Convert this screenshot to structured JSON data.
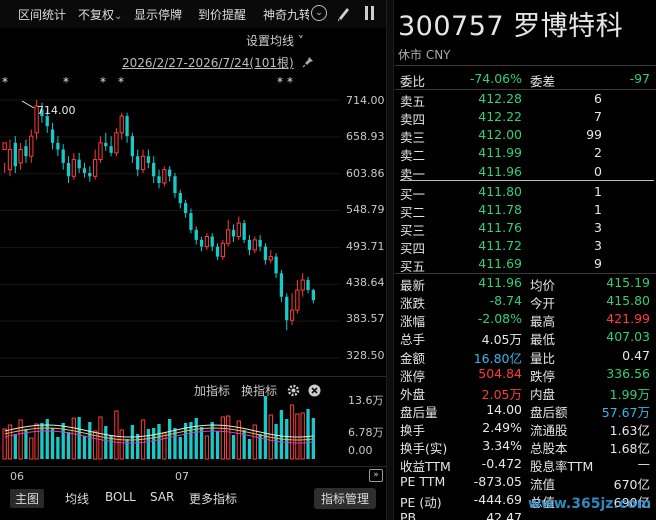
{
  "toolbar": {
    "items": [
      "区间统计",
      "不复权",
      "显示停牌",
      "到价提醒",
      "神奇九转"
    ],
    "dropdown_chev": "⌄",
    "circle_chev": "⌄"
  },
  "chart_header": {
    "ma_setting": "设置均线",
    "date_range": "2026/2/27-2026/7/24(101根)"
  },
  "price_axis": [
    "714.00",
    "658.93",
    "603.86",
    "548.79",
    "493.71",
    "438.64",
    "383.57",
    "328.50"
  ],
  "max_label": "714.00",
  "indicator_bar": {
    "add": "加指标",
    "switch": "换指标"
  },
  "volume_axis": [
    "13.6万",
    "6.78万",
    "0.00"
  ],
  "months": [
    "06",
    "07"
  ],
  "bottom_bar": {
    "items": [
      "主图",
      "均线",
      "BOLL",
      "SAR",
      "更多指标"
    ],
    "manage": "指标管理"
  },
  "stock": {
    "title": "300757 罗博特科",
    "status": "休市 CNY"
  },
  "order_ratio": {
    "label1": "委比",
    "value1": "-74.06%",
    "label2": "委差",
    "value2": "-97"
  },
  "asks": [
    {
      "label": "卖五",
      "price": "412.28",
      "vol": "6"
    },
    {
      "label": "卖四",
      "price": "412.22",
      "vol": "7"
    },
    {
      "label": "卖三",
      "price": "412.00",
      "vol": "99"
    },
    {
      "label": "卖二",
      "price": "411.99",
      "vol": "2"
    },
    {
      "label": "卖一",
      "price": "411.96",
      "vol": "0"
    }
  ],
  "bids": [
    {
      "label": "买一",
      "price": "411.80",
      "vol": "1"
    },
    {
      "label": "买二",
      "price": "411.78",
      "vol": "1"
    },
    {
      "label": "买三",
      "price": "411.76",
      "vol": "3"
    },
    {
      "label": "买四",
      "price": "411.72",
      "vol": "3"
    },
    {
      "label": "买五",
      "price": "411.69",
      "vol": "9"
    }
  ],
  "stats": [
    {
      "l1": "最新",
      "v1": "411.96",
      "c1": "green",
      "l2": "均价",
      "v2": "415.19",
      "c2": "green"
    },
    {
      "l1": "涨跌",
      "v1": "-8.74",
      "c1": "green",
      "l2": "今开",
      "v2": "415.80",
      "c2": "green"
    },
    {
      "l1": "涨幅",
      "v1": "-2.08%",
      "c1": "green",
      "l2": "最高",
      "v2": "421.99",
      "c2": "red"
    },
    {
      "l1": "总手",
      "v1": "4.05万",
      "c1": "white",
      "l2": "最低",
      "v2": "407.03",
      "c2": "green"
    },
    {
      "l1": "金额",
      "v1": "16.80亿",
      "c1": "cyan",
      "l2": "量比",
      "v2": "0.47",
      "c2": "white"
    },
    {
      "l1": "涨停",
      "v1": "504.84",
      "c1": "red",
      "l2": "跌停",
      "v2": "336.56",
      "c2": "green"
    },
    {
      "l1": "外盘",
      "v1": "2.05万",
      "c1": "red",
      "l2": "内盘",
      "v2": "1.99万",
      "c2": "green"
    },
    {
      "l1": "盘后量",
      "v1": "14.00",
      "c1": "white",
      "l2": "盘后额",
      "v2": "57.67万",
      "c2": "cyan"
    },
    {
      "l1": "换手",
      "v1": "2.49%",
      "c1": "white",
      "l2": "流通股",
      "v2": "1.63亿",
      "c2": "white"
    },
    {
      "l1": "换手(实)",
      "v1": "3.34%",
      "c1": "white",
      "l2": "总股本",
      "v2": "1.68亿",
      "c2": "white"
    },
    {
      "l1": "收益TTM",
      "v1": "-0.472",
      "c1": "white",
      "l2": "股息率TTM",
      "v2": "—",
      "c2": "white"
    },
    {
      "l1": "PE TTM",
      "v1": "-873.05",
      "c1": "white",
      "l2": "流值",
      "v2": "670亿",
      "c2": "white"
    },
    {
      "l1": "PE (动)",
      "v1": "-444.69",
      "c1": "white",
      "l2": "总值",
      "v2": "690亿",
      "c2": "white"
    },
    {
      "l1": "PB",
      "v1": "42.47",
      "c1": "white",
      "l2": "",
      "v2": "",
      "c2": "white"
    }
  ],
  "colors": {
    "up": "#ff3b3b",
    "down": "#19c9c9",
    "ma5": "#e8e8e8",
    "ma10": "#e0c040",
    "ma20": "#d040d0"
  },
  "chart_data": {
    "type": "candlestick",
    "ylim": [
      328.5,
      714.0
    ],
    "volume_ylim": [
      0,
      136000
    ],
    "candles": [
      [
        640,
        650,
        620,
        605
      ],
      [
        610,
        640,
        655,
        600
      ],
      [
        650,
        615,
        660,
        605
      ],
      [
        620,
        640,
        650,
        610
      ],
      [
        645,
        630,
        655,
        620
      ],
      [
        630,
        660,
        670,
        620
      ],
      [
        665,
        705,
        714,
        655
      ],
      [
        700,
        690,
        710,
        680
      ],
      [
        690,
        675,
        700,
        665
      ],
      [
        670,
        650,
        680,
        640
      ],
      [
        650,
        640,
        660,
        630
      ],
      [
        640,
        620,
        648,
        610
      ],
      [
        620,
        600,
        630,
        590
      ],
      [
        600,
        625,
        635,
        595
      ],
      [
        625,
        612,
        635,
        605
      ],
      [
        612,
        605,
        620,
        598
      ],
      [
        605,
        600,
        615,
        592
      ],
      [
        600,
        625,
        640,
        595
      ],
      [
        625,
        650,
        660,
        620
      ],
      [
        650,
        645,
        665,
        638
      ],
      [
        645,
        635,
        660,
        630
      ],
      [
        635,
        665,
        672,
        630
      ],
      [
        665,
        690,
        695,
        655
      ],
      [
        690,
        660,
        695,
        650
      ],
      [
        660,
        630,
        665,
        620
      ],
      [
        630,
        610,
        640,
        600
      ],
      [
        610,
        630,
        640,
        605
      ],
      [
        630,
        620,
        640,
        612
      ],
      [
        620,
        600,
        630,
        590
      ],
      [
        600,
        590,
        610,
        582
      ],
      [
        590,
        610,
        615,
        585
      ],
      [
        610,
        600,
        615,
        592
      ],
      [
        600,
        575,
        605,
        568
      ],
      [
        575,
        560,
        580,
        552
      ],
      [
        560,
        545,
        565,
        538
      ],
      [
        545,
        520,
        552,
        515
      ],
      [
        520,
        505,
        525,
        498
      ],
      [
        505,
        495,
        510,
        488
      ],
      [
        495,
        510,
        515,
        490
      ],
      [
        510,
        495,
        515,
        488
      ],
      [
        495,
        480,
        500,
        475
      ],
      [
        480,
        500,
        505,
        475
      ],
      [
        500,
        520,
        535,
        495
      ],
      [
        520,
        510,
        528,
        502
      ],
      [
        510,
        530,
        540,
        505
      ],
      [
        530,
        505,
        535,
        500
      ],
      [
        505,
        490,
        512,
        482
      ],
      [
        490,
        505,
        510,
        485
      ],
      [
        505,
        495,
        512,
        488
      ],
      [
        495,
        475,
        500,
        468
      ],
      [
        475,
        480,
        490,
        470
      ],
      [
        480,
        455,
        485,
        448
      ],
      [
        455,
        420,
        460,
        412
      ],
      [
        420,
        385,
        425,
        370
      ],
      [
        385,
        400,
        425,
        378
      ],
      [
        400,
        430,
        445,
        395
      ],
      [
        430,
        445,
        455,
        420
      ],
      [
        445,
        430,
        450,
        425
      ],
      [
        430,
        415,
        432,
        410
      ]
    ]
  }
}
